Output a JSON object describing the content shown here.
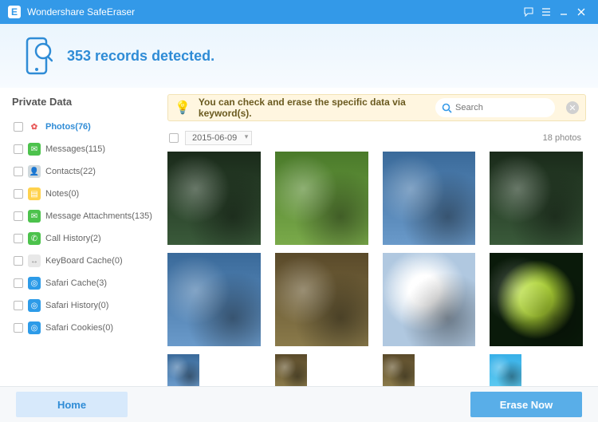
{
  "titlebar": {
    "title": "Wondershare SafeEraser"
  },
  "hero": {
    "detected_text": "353 records detected."
  },
  "sidebar": {
    "title": "Private Data",
    "items": [
      {
        "label": "Photos(76)",
        "selected": true,
        "icon_bg": "#ffffff",
        "icon_glyph": "✿",
        "icon_color": "#e85a5a"
      },
      {
        "label": "Messages(115)",
        "selected": false,
        "icon_bg": "#4cc24c",
        "icon_glyph": "✉"
      },
      {
        "label": "Contacts(22)",
        "selected": false,
        "icon_bg": "#cfd8dc",
        "icon_glyph": "👤"
      },
      {
        "label": "Notes(0)",
        "selected": false,
        "icon_bg": "#ffd24d",
        "icon_glyph": "▤"
      },
      {
        "label": "Message Attachments(135)",
        "selected": false,
        "icon_bg": "#4cc24c",
        "icon_glyph": "✉"
      },
      {
        "label": "Call History(2)",
        "selected": false,
        "icon_bg": "#4cc24c",
        "icon_glyph": "✆"
      },
      {
        "label": "KeyBoard Cache(0)",
        "selected": false,
        "icon_bg": "#e8e8e8",
        "icon_glyph": "↔",
        "icon_color": "#888"
      },
      {
        "label": "Safari Cache(3)",
        "selected": false,
        "icon_bg": "#2d9be8",
        "icon_glyph": "◎"
      },
      {
        "label": "Safari History(0)",
        "selected": false,
        "icon_bg": "#2d9be8",
        "icon_glyph": "◎"
      },
      {
        "label": "Safari Cookies(0)",
        "selected": false,
        "icon_bg": "#2d9be8",
        "icon_glyph": "◎"
      }
    ]
  },
  "tipbar": {
    "text": "You can check and erase the specific data via keyword(s).",
    "search_placeholder": "Search"
  },
  "date_group": {
    "date": "2015-06-09",
    "count_label": "18 photos"
  },
  "thumbnails": [
    {
      "name": "photo-gorilla-face",
      "cls": "t-dark"
    },
    {
      "name": "photo-primate-mother",
      "cls": "t-green"
    },
    {
      "name": "photo-chimp-portrait",
      "cls": "t-blue"
    },
    {
      "name": "photo-young-chimp",
      "cls": "t-dark"
    },
    {
      "name": "photo-bear-splash",
      "cls": "t-blue"
    },
    {
      "name": "photo-bear-closeup",
      "cls": "t-brown"
    },
    {
      "name": "photo-seagull",
      "cls": "t-white"
    },
    {
      "name": "photo-tree-frog",
      "cls": "t-frog"
    },
    {
      "name": "photo-egret",
      "cls": "t-blue"
    },
    {
      "name": "photo-owl",
      "cls": "t-brown"
    },
    {
      "name": "photo-owl-branch",
      "cls": "t-brown"
    },
    {
      "name": "photo-parrots",
      "cls": "t-sky"
    }
  ],
  "footer": {
    "home_label": "Home",
    "erase_label": "Erase Now"
  }
}
